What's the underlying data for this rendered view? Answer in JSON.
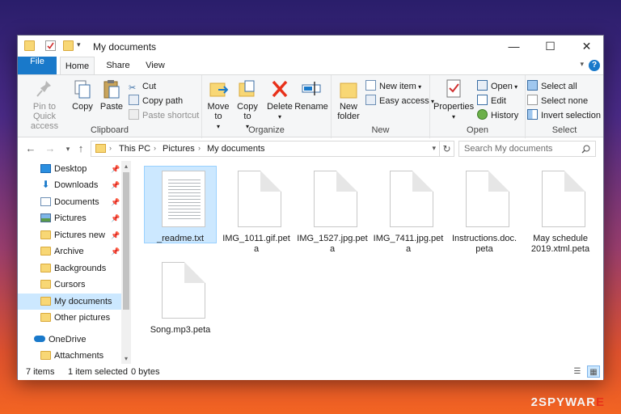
{
  "window": {
    "title": "My documents",
    "controls": {
      "minimize": "—",
      "maximize": "☐",
      "close": "✕"
    }
  },
  "tabs": [
    {
      "label": "File"
    },
    {
      "label": "Home"
    },
    {
      "label": "Share"
    },
    {
      "label": "View"
    }
  ],
  "help_label": "?",
  "ribbon": {
    "clipboard": {
      "label": "Clipboard",
      "pin": "Pin to Quick access",
      "copy": "Copy",
      "paste": "Paste",
      "cut": "Cut",
      "copy_path": "Copy path",
      "paste_shortcut": "Paste shortcut"
    },
    "organize": {
      "label": "Organize",
      "move_to": "Move to",
      "copy_to": "Copy to",
      "delete": "Delete",
      "rename": "Rename"
    },
    "new": {
      "label": "New",
      "new_folder": "New folder",
      "new_item": "New item",
      "easy_access": "Easy access"
    },
    "open": {
      "label": "Open",
      "properties": "Properties",
      "open": "Open",
      "edit": "Edit",
      "history": "History"
    },
    "select": {
      "label": "Select",
      "select_all": "Select all",
      "select_none": "Select none",
      "invert_selection": "Invert selection"
    }
  },
  "address": {
    "crumbs": [
      "This PC",
      "Pictures",
      "My documents"
    ],
    "search_placeholder": "Search My documents"
  },
  "nav_pane": {
    "items": [
      {
        "label": "Desktop",
        "pinned": true
      },
      {
        "label": "Downloads",
        "pinned": true
      },
      {
        "label": "Documents",
        "pinned": true
      },
      {
        "label": "Pictures",
        "pinned": true
      },
      {
        "label": "Pictures new",
        "pinned": true
      },
      {
        "label": "Archive",
        "pinned": true
      },
      {
        "label": "Backgrounds",
        "pinned": false
      },
      {
        "label": "Cursors",
        "pinned": false
      },
      {
        "label": "My documents",
        "pinned": false,
        "selected": true
      },
      {
        "label": "Other pictures",
        "pinned": false
      },
      {
        "label": "OneDrive",
        "pinned": false
      },
      {
        "label": "Attachments",
        "pinned": false
      }
    ]
  },
  "files": [
    {
      "line1": "_readme.txt",
      "line2": "",
      "selected": true
    },
    {
      "line1": "IMG_1011.gif.pet",
      "line2": "a"
    },
    {
      "line1": "IMG_1527.jpg.pet",
      "line2": "a"
    },
    {
      "line1": "IMG_7411.jpg.pet",
      "line2": "a"
    },
    {
      "line1": "Instructions.doc.",
      "line2": "peta"
    },
    {
      "line1": "May schedule",
      "line2": "2019.xtml.peta"
    },
    {
      "line1": "Song.mp3.peta",
      "line2": ""
    }
  ],
  "status": {
    "item_count": "7 items",
    "selected_info": "1 item selected",
    "size": "0 bytes"
  },
  "watermark": {
    "main": "2SPYWAR",
    "accent": "E"
  },
  "colors": {
    "accent": "#1979ca",
    "selection": "#cce8ff",
    "folder": "#f8d775",
    "delete": "#e8311a"
  }
}
